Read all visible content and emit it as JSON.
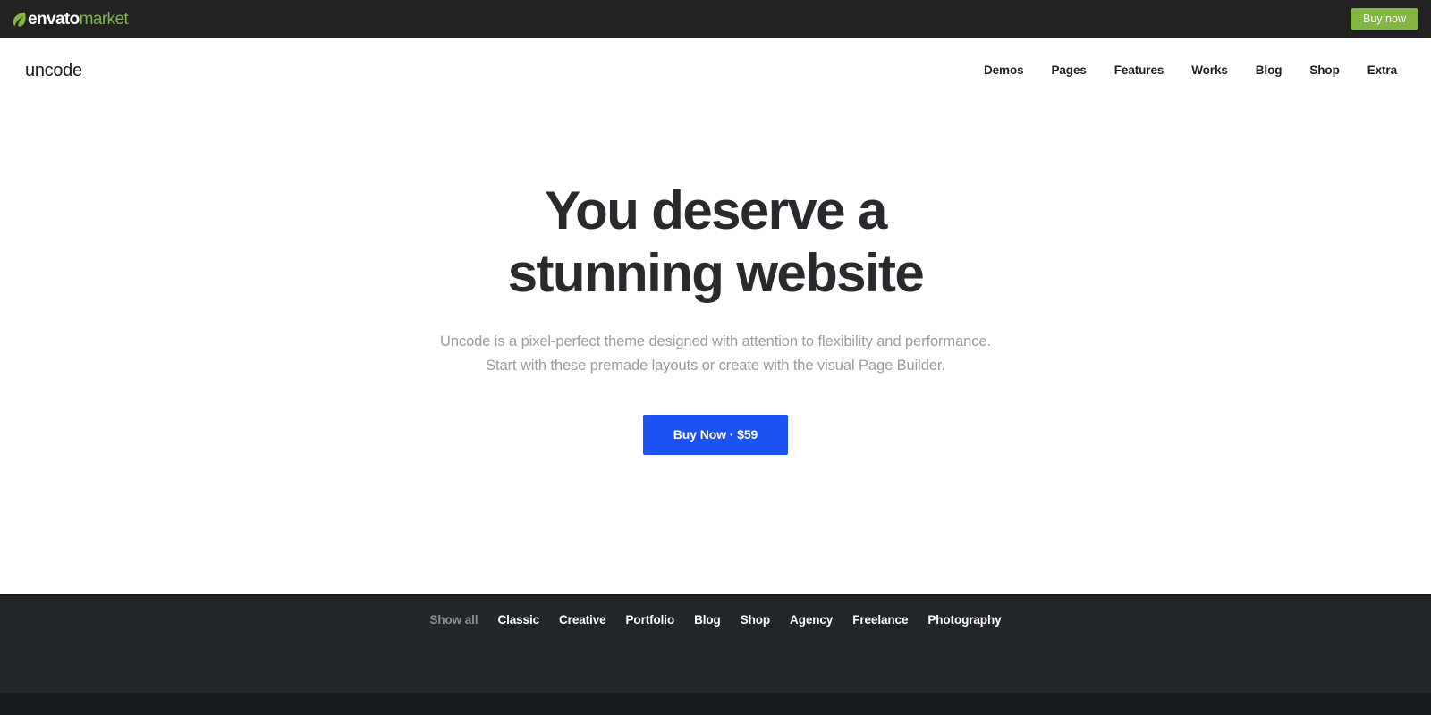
{
  "envato_bar": {
    "logo": {
      "icon": "leaf-icon",
      "word_primary": "envato",
      "word_secondary": "market"
    },
    "buy_now_label": "Buy now",
    "background": "#222222",
    "accent": "#82b541"
  },
  "header": {
    "brand": "uncode",
    "nav": [
      {
        "label": "Demos"
      },
      {
        "label": "Pages"
      },
      {
        "label": "Features"
      },
      {
        "label": "Works"
      },
      {
        "label": "Blog"
      },
      {
        "label": "Shop"
      },
      {
        "label": "Extra"
      }
    ]
  },
  "hero": {
    "title_line_1": "You deserve a",
    "title_line_2": "stunning website",
    "subtitle_line_1": "Uncode is a pixel-perfect theme designed with attention to flexibility and performance.",
    "subtitle_line_2": "Start with these premade layouts or create with the visual Page Builder.",
    "cta_label": "Buy Now · $59",
    "cta_color": "#1c51f2",
    "title_color": "#2a2a2e",
    "subtitle_color": "#9a9ca1"
  },
  "filters": {
    "background": "#222529",
    "items": [
      {
        "label": "Show all",
        "active": false
      },
      {
        "label": "Classic",
        "active": true
      },
      {
        "label": "Creative",
        "active": true
      },
      {
        "label": "Portfolio",
        "active": true
      },
      {
        "label": "Blog",
        "active": true
      },
      {
        "label": "Shop",
        "active": true
      },
      {
        "label": "Agency",
        "active": true
      },
      {
        "label": "Freelance",
        "active": true
      },
      {
        "label": "Photography",
        "active": true
      }
    ]
  }
}
